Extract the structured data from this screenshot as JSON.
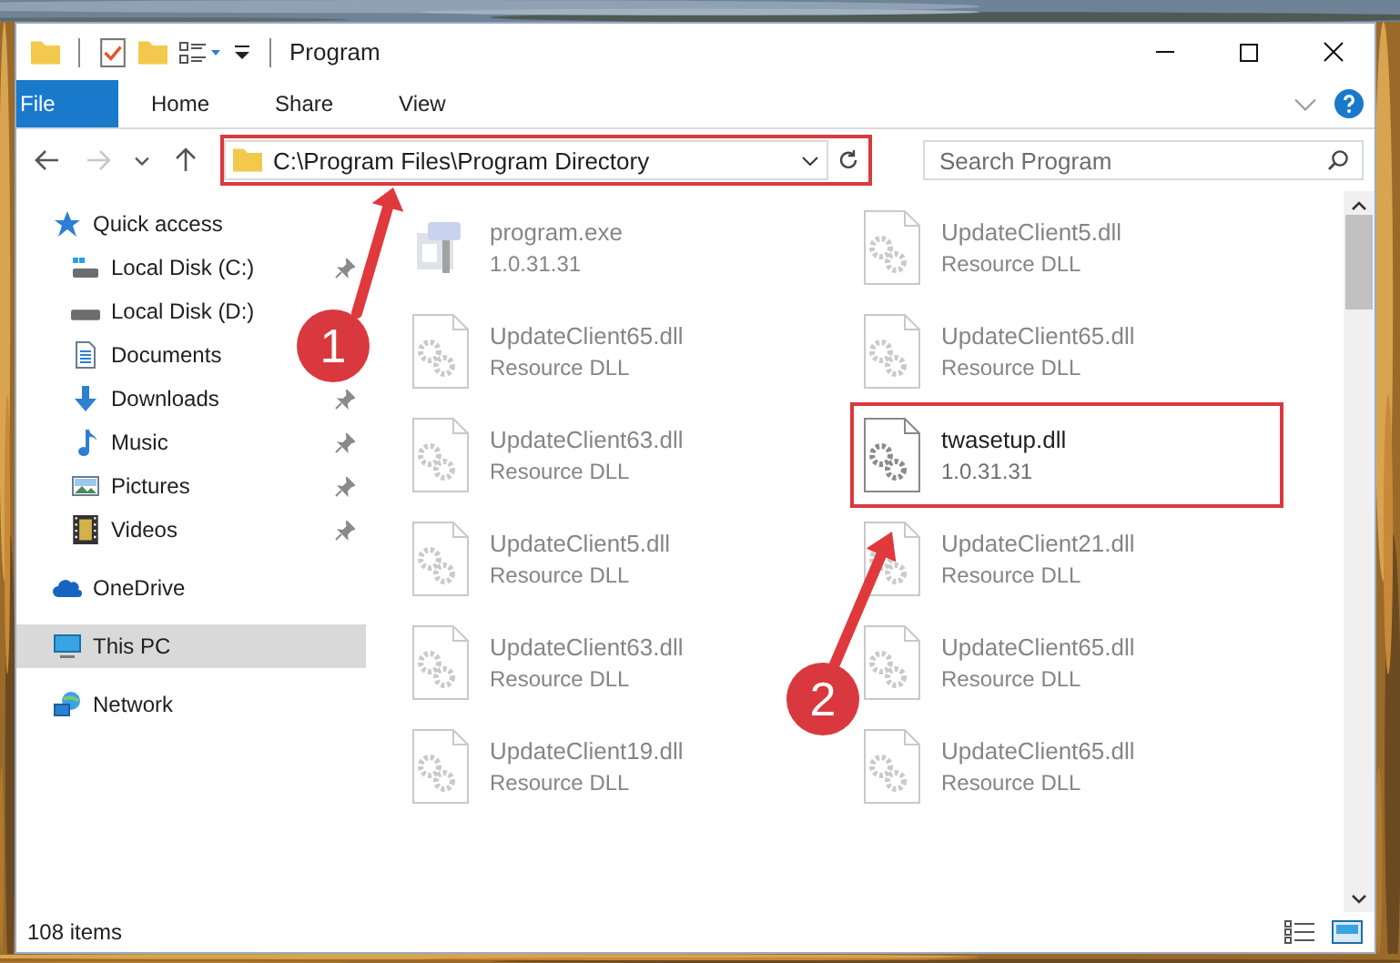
{
  "window": {
    "title": "Program"
  },
  "ribbon_tabs": [
    {
      "label": "File",
      "kind": "file"
    },
    {
      "label": "Home",
      "kind": "tab"
    },
    {
      "label": "Share",
      "kind": "tab"
    },
    {
      "label": "View",
      "kind": "tab"
    }
  ],
  "address_bar": {
    "path": "C:\\Program Files\\Program Directory",
    "highlighted": true
  },
  "search": {
    "placeholder": "Search Program"
  },
  "sidebar": {
    "items": [
      {
        "label": "Quick access",
        "kind": "star",
        "selected": false,
        "children": [
          {
            "label": "Local Disk (C:)",
            "kind": "system-drive",
            "pinned": true
          },
          {
            "label": "Local Disk (D:)",
            "kind": "drive",
            "pinned": false
          },
          {
            "label": "Documents",
            "kind": "documents",
            "pinned": false
          },
          {
            "label": "Downloads",
            "kind": "downloads",
            "pinned": true
          },
          {
            "label": "Music",
            "kind": "music",
            "pinned": true
          },
          {
            "label": "Pictures",
            "kind": "pictures",
            "pinned": true
          },
          {
            "label": "Videos",
            "kind": "videos",
            "pinned": true
          }
        ]
      },
      {
        "label": "OneDrive",
        "kind": "cloud",
        "selected": false
      },
      {
        "label": "This PC",
        "kind": "pc",
        "selected": true
      },
      {
        "label": "Network",
        "kind": "network",
        "selected": false
      }
    ]
  },
  "files": [
    {
      "name": "program.exe",
      "detail": "1.0.31.31",
      "kind": "exe",
      "blurred": true,
      "highlighted": false
    },
    {
      "name": "UpdateClient5.dll",
      "detail": "Resource DLL",
      "kind": "dll",
      "blurred": true,
      "highlighted": false
    },
    {
      "name": "UpdateClient65.dll",
      "detail": "Resource DLL",
      "kind": "dll",
      "blurred": true,
      "highlighted": false
    },
    {
      "name": "UpdateClient65.dll",
      "detail": "Resource DLL",
      "kind": "dll",
      "blurred": true,
      "highlighted": false
    },
    {
      "name": "UpdateClient63.dll",
      "detail": "Resource DLL",
      "kind": "dll",
      "blurred": true,
      "highlighted": false
    },
    {
      "name": "twasetup.dll",
      "detail": "1.0.31.31",
      "kind": "dll",
      "blurred": false,
      "highlighted": true
    },
    {
      "name": "UpdateClient5.dll",
      "detail": "Resource DLL",
      "kind": "dll",
      "blurred": true,
      "highlighted": false
    },
    {
      "name": "UpdateClient21.dll",
      "detail": "Resource DLL",
      "kind": "dll",
      "blurred": true,
      "highlighted": false
    },
    {
      "name": "UpdateClient63.dll",
      "detail": "Resource DLL",
      "kind": "dll",
      "blurred": true,
      "highlighted": false
    },
    {
      "name": "UpdateClient65.dll",
      "detail": "Resource DLL",
      "kind": "dll",
      "blurred": true,
      "highlighted": false
    },
    {
      "name": "UpdateClient19.dll",
      "detail": "Resource DLL",
      "kind": "dll",
      "blurred": true,
      "highlighted": false
    },
    {
      "name": "UpdateClient65.dll",
      "detail": "Resource DLL",
      "kind": "dll",
      "blurred": true,
      "highlighted": false
    }
  ],
  "callouts": [
    {
      "number": "1"
    },
    {
      "number": "2"
    }
  ],
  "status_bar": {
    "item_count": "108 items"
  }
}
